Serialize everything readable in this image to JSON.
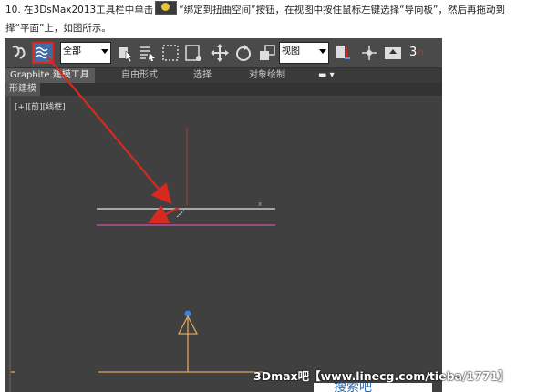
{
  "instruction": {
    "line1_before": "10. 在3DsMax2013工具栏中单击",
    "line1_after": "“绑定到扭曲空间”按钮，在视图中按住鼠标左键选择“导向板”，然后再拖动到",
    "line2": "择“平面”上，如图所示。",
    "inline_icon": "bind-to-space-warp-icon"
  },
  "toolbar": {
    "selection_filter": "全部",
    "coordinate_system": "视图",
    "snap_value": "3"
  },
  "ribbon": {
    "tabs": [
      "Graphite 建模工具",
      "自由形式",
      "选择",
      "对象绘制"
    ]
  },
  "subbar": {
    "label": "形建模"
  },
  "viewport": {
    "label": "[+][前][线框]"
  },
  "watermark": "3Dmax吧【www.linecg.com/tieba/1771】",
  "footer_text": "搜索吧",
  "colors": {
    "arrow": "#d8291f",
    "highlight_border": "#d8291f",
    "viewport_bg": "#404040",
    "deflector_line": "#c8c8c8",
    "plane_line": "#b64f9a",
    "axis_red": "#a3413a",
    "gizmo_orange": "#e0a25a",
    "gizmo_blue": "#3b82e0"
  }
}
